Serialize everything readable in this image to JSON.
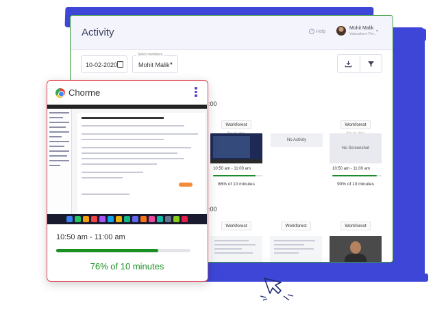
{
  "page": {
    "title": "Activity"
  },
  "header": {
    "help_label": "Help",
    "user_name": "Mohit Malik",
    "user_org": "Vakeuslerre Pvt..."
  },
  "filters": {
    "date": "10-02-2020",
    "member_legend": "Select members",
    "member": "Mohit Malik"
  },
  "timeline": {
    "row1_time": "0:00",
    "row2_time": "0:00",
    "row1": [
      {
        "app": "Workforest",
        "todo": "No to-dos",
        "time": "10:50 am - 11:00 am",
        "percent": "86% of 10 minutes",
        "progress": 0.86
      },
      {
        "status": "No Activity"
      },
      {
        "app": "Workforest",
        "todo": "No to-dos",
        "screenshot": "No Screenshot",
        "time": "10:50 am - 11:00 am",
        "percent": "90% of 10 minutes",
        "progress": 0.9
      }
    ],
    "row2": [
      {
        "app": "Workforest"
      },
      {
        "app": "Workforest"
      },
      {
        "app": "Workforest"
      }
    ]
  },
  "overlay": {
    "app_name": "Chorme",
    "time_range": "10:50 am - 11:00 am",
    "percent": "76% of 10 minutes",
    "progress": 0.76
  },
  "colors": {
    "accent_blue": "#3d46d6",
    "progress_green": "#1a8f22",
    "card_border_red": "#e0404f",
    "card_border_green": "#3a9d3a"
  }
}
